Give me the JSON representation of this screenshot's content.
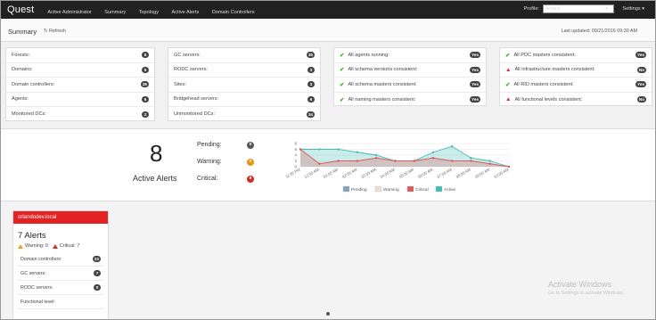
{
  "nav": {
    "logo": "Quest",
    "items": [
      "Active Administrator",
      "Summary",
      "Topology",
      "Active Alerts",
      "Domain Controllers"
    ],
    "profile_label": "Profile:",
    "profile_value": "default",
    "settings": "Settings ▾"
  },
  "summary": {
    "title": "Summary",
    "refresh": "Refresh",
    "last_updated": "Last updated: 09/21/2016 09:30 AM"
  },
  "panel_forest": [
    {
      "label": "Forests:",
      "value": "5"
    },
    {
      "label": "Domains:",
      "value": "5"
    },
    {
      "label": "Domain controllers:",
      "value": "36"
    },
    {
      "label": "Agents:",
      "value": "6"
    },
    {
      "label": "Monitored DCs:",
      "value": "2"
    }
  ],
  "panel_servers": [
    {
      "label": "GC servers:",
      "value": "35"
    },
    {
      "label": "RODC servers:",
      "value": "3"
    },
    {
      "label": "Sites:",
      "value": "3"
    },
    {
      "label": "Bridgehead servers:",
      "value": "6"
    },
    {
      "label": "Unmonitored DCs:",
      "value": "34"
    }
  ],
  "panel_health": [
    {
      "label": "All agents running:",
      "value": "Yes",
      "ok": true
    },
    {
      "label": "All schema versions consistent:",
      "value": "Yes",
      "ok": true
    },
    {
      "label": "All schema masters consistent:",
      "value": "Yes",
      "ok": true
    },
    {
      "label": "All naming masters consistent:",
      "value": "Yes",
      "ok": true
    }
  ],
  "panel_masters": [
    {
      "label": "All PDC masters consistent:",
      "value": "Yes",
      "ok": true
    },
    {
      "label": "All infrastructure masters consistent:",
      "value": "No",
      "ok": false
    },
    {
      "label": "All RID masters consistent:",
      "value": "Yes",
      "ok": true
    },
    {
      "label": "All functional levels consistent:",
      "value": "No",
      "ok": false
    }
  ],
  "alerts": {
    "count": "8",
    "count_label": "Active Alerts",
    "pending_label": "Pending:",
    "pending": "0",
    "warning_label": "Warning:",
    "warning": "0",
    "critical_label": "Critical:",
    "critical": "8"
  },
  "colors": {
    "pending": "#7fa6c4",
    "warning": "#e8e0d6",
    "critical": "#e05858",
    "active": "#3fbdb6",
    "red": "#e32323"
  },
  "chart_data": {
    "type": "area",
    "x": [
      "11:00 PM",
      "12:00 AM",
      "01:00 AM",
      "02:00 AM",
      "03:00 AM",
      "04:00 AM",
      "05:00 AM",
      "06:00 AM",
      "07:00 AM",
      "08:00 AM",
      "09:00 AM",
      "10:00 AM"
    ],
    "ylim": [
      0,
      8
    ],
    "yticks": [
      "8",
      "6",
      "4",
      "2",
      "0"
    ],
    "series": [
      {
        "name": "Pending",
        "values": [
          0,
          0,
          0,
          0,
          0,
          0,
          0,
          0,
          0,
          0,
          0,
          0
        ]
      },
      {
        "name": "Warning",
        "values": [
          0,
          0,
          0,
          0,
          0,
          0,
          0,
          0,
          0,
          0,
          0,
          0
        ]
      },
      {
        "name": "Critical",
        "values": [
          6,
          1,
          2,
          2,
          3,
          2,
          2,
          3,
          2,
          2,
          1,
          0
        ]
      },
      {
        "name": "Active",
        "values": [
          6,
          6,
          6,
          5,
          4,
          2,
          2,
          5,
          7,
          3,
          2,
          0
        ]
      }
    ]
  },
  "domain": {
    "name": "orlandodev.local",
    "alerts": "7 Alerts",
    "warning": "Warning: 0",
    "critical": "Critical: 7",
    "rows": [
      {
        "label": "Domain controllers:",
        "value": "23"
      },
      {
        "label": "GC servers:",
        "value": "7"
      },
      {
        "label": "RODC servers:",
        "value": "0"
      },
      {
        "label": "Functional level:",
        "value": ""
      }
    ]
  },
  "watermark": {
    "title": "Activate Windows",
    "sub": "Go to Settings to activate Windows."
  }
}
